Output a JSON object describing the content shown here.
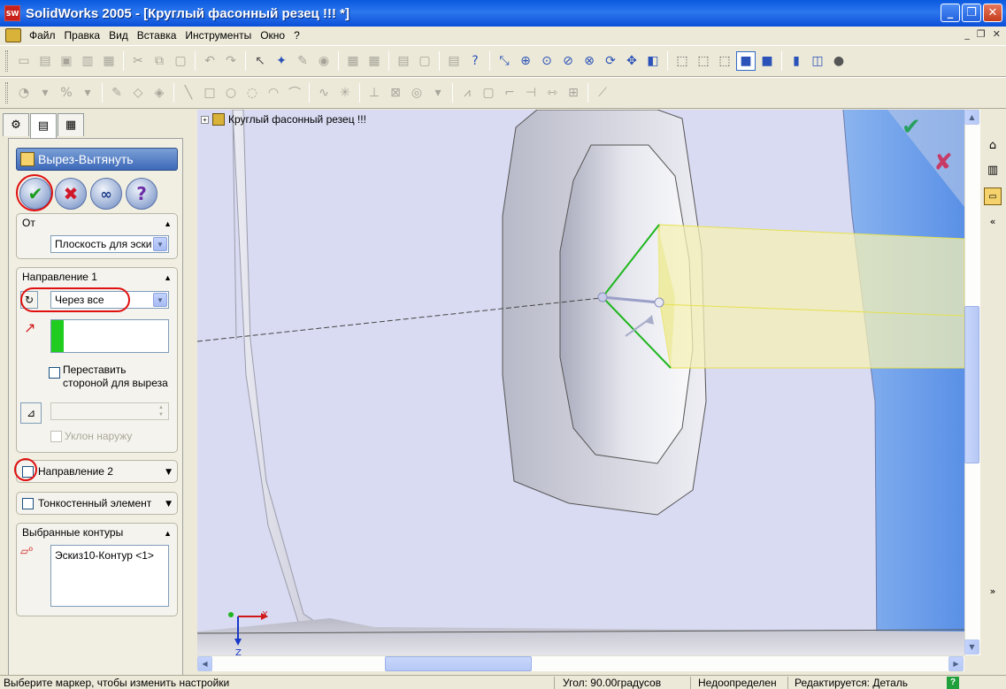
{
  "window": {
    "app_icon": "SW",
    "title": "SolidWorks 2005 - [Круглый фасонный резец !!! *]",
    "minimize": "_",
    "restore": "❐",
    "close": "✕"
  },
  "menu": {
    "items": [
      "Файл",
      "Правка",
      "Вид",
      "Вставка",
      "Инструменты",
      "Окно",
      "?"
    ],
    "mdi": [
      "_",
      "❐",
      "✕"
    ]
  },
  "tree": {
    "root_label": "Круглый фасонный резец !!!",
    "expand": "+"
  },
  "panel": {
    "tabs": [
      "feature-manager-tab",
      "property-manager-tab",
      "configuration-manager-tab"
    ],
    "feature_title": "Вырез-Вытянуть",
    "from": {
      "header": "От",
      "value": "Плоскость для эски"
    },
    "direction1": {
      "header": "Направление 1",
      "end_condition": "Через все",
      "flip_label": "Переставить стороной для выреза",
      "flip_line1": "Переставить",
      "flip_line2": "стороной для выреза",
      "draft_value": "",
      "draft_outward": "Уклон наружу"
    },
    "direction2": {
      "header": "Направление 2"
    },
    "thin": {
      "header": "Тонкостенный элемент"
    },
    "contours": {
      "header": "Выбранные контуры",
      "items": [
        "Эскиз10-Контур <1>"
      ]
    }
  },
  "triad": {
    "x": "X",
    "z": "Z"
  },
  "status": {
    "hint": "Выберите маркер, чтобы изменить настройки",
    "angle": "Угол: 90.00градусов",
    "sketch_state": "Недоопределен",
    "editing": "Редактируется: Деталь",
    "help": "?"
  },
  "colors": {
    "title_bar": "#0a5ae0",
    "viewport_bg": "#d8daf0",
    "preview_yellow": "#f3f0b8",
    "sketch_green": "#1fb61f",
    "highlight_ring": "#e01010"
  }
}
